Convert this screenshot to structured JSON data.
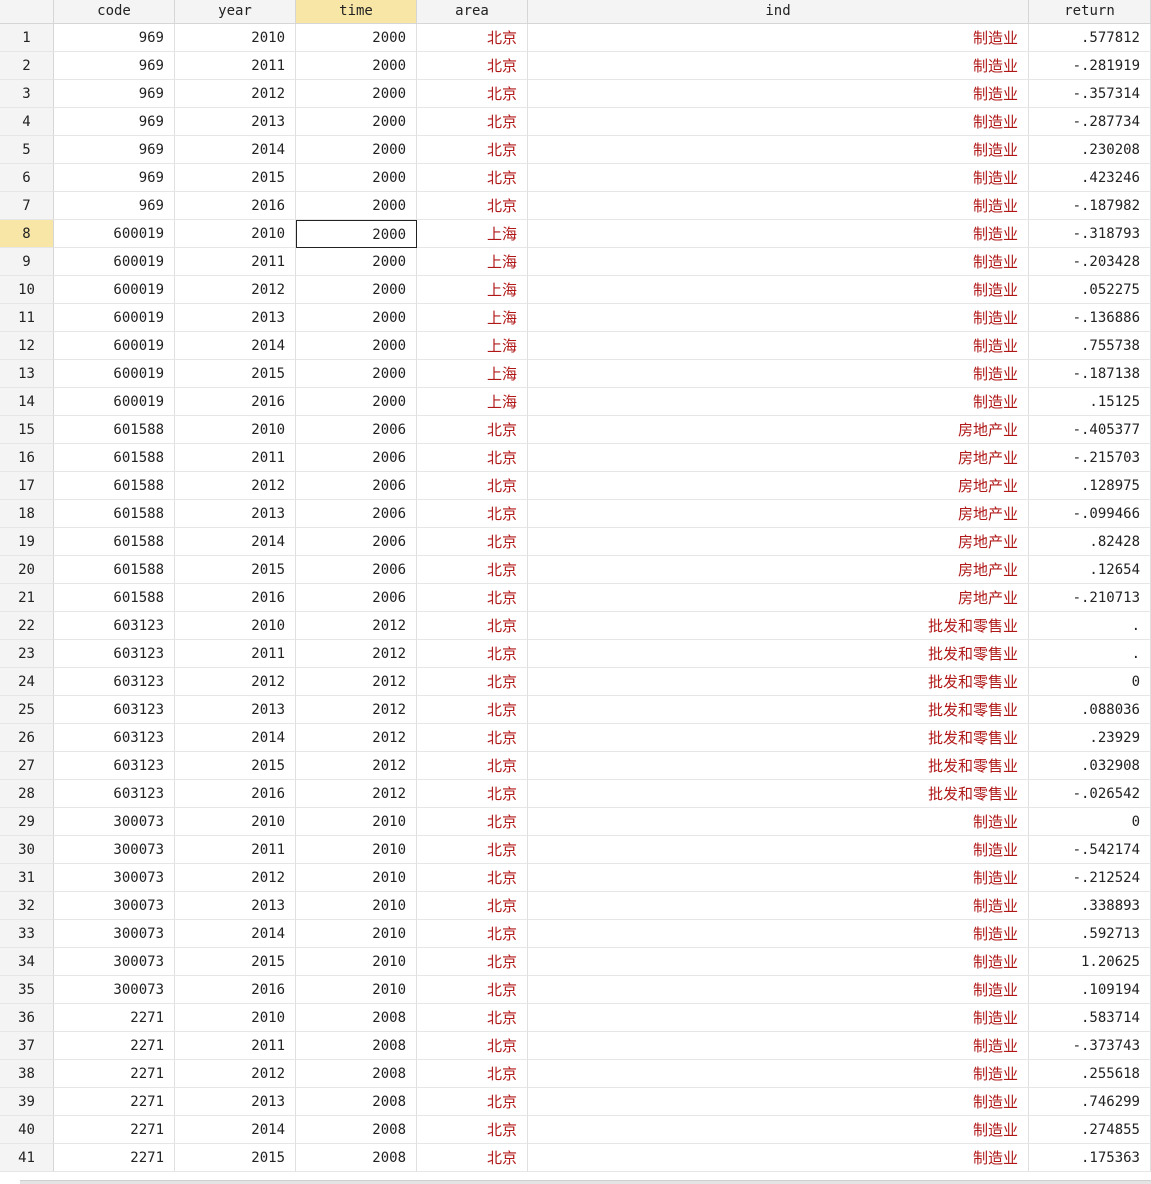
{
  "columns": [
    {
      "key": "code",
      "label": "code",
      "type": "num"
    },
    {
      "key": "year",
      "label": "year",
      "type": "num"
    },
    {
      "key": "time",
      "label": "time",
      "type": "num",
      "selected": true
    },
    {
      "key": "area",
      "label": "area",
      "type": "str"
    },
    {
      "key": "ind",
      "label": "ind",
      "type": "str"
    },
    {
      "key": "return",
      "label": "return",
      "type": "num"
    }
  ],
  "active_cell": {
    "row": 8,
    "column": "time"
  },
  "colors": {
    "string_text": "#b01818",
    "selected_header": "#f8e6a6"
  },
  "rows": [
    [
      "969",
      "2010",
      "2000",
      "北京",
      "制造业",
      ".577812"
    ],
    [
      "969",
      "2011",
      "2000",
      "北京",
      "制造业",
      "-.281919"
    ],
    [
      "969",
      "2012",
      "2000",
      "北京",
      "制造业",
      "-.357314"
    ],
    [
      "969",
      "2013",
      "2000",
      "北京",
      "制造业",
      "-.287734"
    ],
    [
      "969",
      "2014",
      "2000",
      "北京",
      "制造业",
      ".230208"
    ],
    [
      "969",
      "2015",
      "2000",
      "北京",
      "制造业",
      ".423246"
    ],
    [
      "969",
      "2016",
      "2000",
      "北京",
      "制造业",
      "-.187982"
    ],
    [
      "600019",
      "2010",
      "2000",
      "上海",
      "制造业",
      "-.318793"
    ],
    [
      "600019",
      "2011",
      "2000",
      "上海",
      "制造业",
      "-.203428"
    ],
    [
      "600019",
      "2012",
      "2000",
      "上海",
      "制造业",
      ".052275"
    ],
    [
      "600019",
      "2013",
      "2000",
      "上海",
      "制造业",
      "-.136886"
    ],
    [
      "600019",
      "2014",
      "2000",
      "上海",
      "制造业",
      ".755738"
    ],
    [
      "600019",
      "2015",
      "2000",
      "上海",
      "制造业",
      "-.187138"
    ],
    [
      "600019",
      "2016",
      "2000",
      "上海",
      "制造业",
      ".15125"
    ],
    [
      "601588",
      "2010",
      "2006",
      "北京",
      "房地产业",
      "-.405377"
    ],
    [
      "601588",
      "2011",
      "2006",
      "北京",
      "房地产业",
      "-.215703"
    ],
    [
      "601588",
      "2012",
      "2006",
      "北京",
      "房地产业",
      ".128975"
    ],
    [
      "601588",
      "2013",
      "2006",
      "北京",
      "房地产业",
      "-.099466"
    ],
    [
      "601588",
      "2014",
      "2006",
      "北京",
      "房地产业",
      ".82428"
    ],
    [
      "601588",
      "2015",
      "2006",
      "北京",
      "房地产业",
      ".12654"
    ],
    [
      "601588",
      "2016",
      "2006",
      "北京",
      "房地产业",
      "-.210713"
    ],
    [
      "603123",
      "2010",
      "2012",
      "北京",
      "批发和零售业",
      "."
    ],
    [
      "603123",
      "2011",
      "2012",
      "北京",
      "批发和零售业",
      "."
    ],
    [
      "603123",
      "2012",
      "2012",
      "北京",
      "批发和零售业",
      "0"
    ],
    [
      "603123",
      "2013",
      "2012",
      "北京",
      "批发和零售业",
      ".088036"
    ],
    [
      "603123",
      "2014",
      "2012",
      "北京",
      "批发和零售业",
      ".23929"
    ],
    [
      "603123",
      "2015",
      "2012",
      "北京",
      "批发和零售业",
      ".032908"
    ],
    [
      "603123",
      "2016",
      "2012",
      "北京",
      "批发和零售业",
      "-.026542"
    ],
    [
      "300073",
      "2010",
      "2010",
      "北京",
      "制造业",
      "0"
    ],
    [
      "300073",
      "2011",
      "2010",
      "北京",
      "制造业",
      "-.542174"
    ],
    [
      "300073",
      "2012",
      "2010",
      "北京",
      "制造业",
      "-.212524"
    ],
    [
      "300073",
      "2013",
      "2010",
      "北京",
      "制造业",
      ".338893"
    ],
    [
      "300073",
      "2014",
      "2010",
      "北京",
      "制造业",
      ".592713"
    ],
    [
      "300073",
      "2015",
      "2010",
      "北京",
      "制造业",
      "1.20625"
    ],
    [
      "300073",
      "2016",
      "2010",
      "北京",
      "制造业",
      ".109194"
    ],
    [
      "2271",
      "2010",
      "2008",
      "北京",
      "制造业",
      ".583714"
    ],
    [
      "2271",
      "2011",
      "2008",
      "北京",
      "制造业",
      "-.373743"
    ],
    [
      "2271",
      "2012",
      "2008",
      "北京",
      "制造业",
      ".255618"
    ],
    [
      "2271",
      "2013",
      "2008",
      "北京",
      "制造业",
      ".746299"
    ],
    [
      "2271",
      "2014",
      "2008",
      "北京",
      "制造业",
      ".274855"
    ],
    [
      "2271",
      "2015",
      "2008",
      "北京",
      "制造业",
      ".175363"
    ]
  ]
}
